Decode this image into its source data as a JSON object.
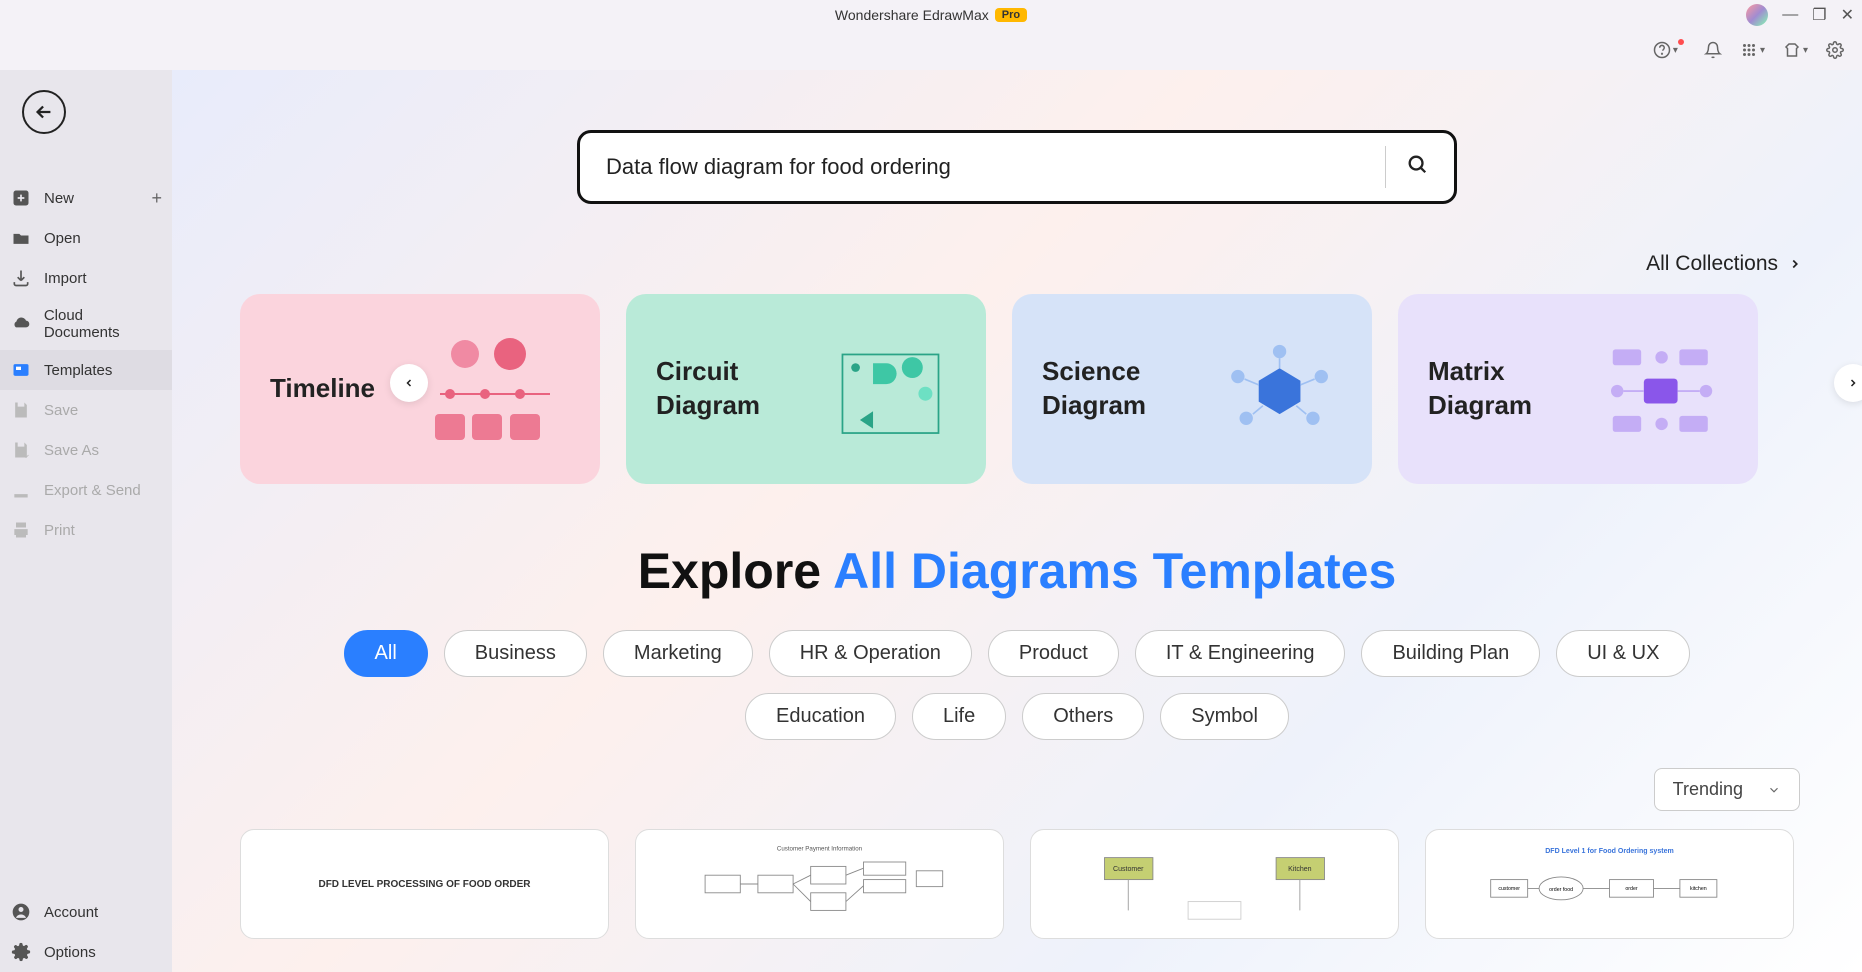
{
  "titlebar": {
    "app_name": "Wondershare EdrawMax",
    "badge": "Pro"
  },
  "sidebar": {
    "items": [
      {
        "label": "New",
        "icon": "plus-square",
        "has_plus": true
      },
      {
        "label": "Open",
        "icon": "folder"
      },
      {
        "label": "Import",
        "icon": "import"
      },
      {
        "label": "Cloud Documents",
        "icon": "cloud"
      },
      {
        "label": "Templates",
        "icon": "template",
        "active": true
      },
      {
        "label": "Save",
        "icon": "save",
        "disabled": true
      },
      {
        "label": "Save As",
        "icon": "saveas",
        "disabled": true
      },
      {
        "label": "Export & Send",
        "icon": "export",
        "disabled": true
      },
      {
        "label": "Print",
        "icon": "print",
        "disabled": true
      }
    ],
    "footer": [
      {
        "label": "Account",
        "icon": "account"
      },
      {
        "label": "Options",
        "icon": "gear"
      }
    ]
  },
  "search": {
    "value": "Data flow diagram for food ordering"
  },
  "collections_link": "All Collections",
  "categories": [
    {
      "title": "Timeline"
    },
    {
      "title": "Circuit Diagram"
    },
    {
      "title": "Science Diagram"
    },
    {
      "title": "Matrix Diagram"
    }
  ],
  "explore": {
    "prefix": "Explore ",
    "highlight": "All Diagrams Templates"
  },
  "filters": [
    "All",
    "Business",
    "Marketing",
    "HR & Operation",
    "Product",
    "IT & Engineering",
    "Building Plan",
    "UI & UX",
    "Education",
    "Life",
    "Others",
    "Symbol"
  ],
  "sort": {
    "selected": "Trending"
  },
  "templates": [
    {
      "caption": "DFD LEVEL PROCESSING OF FOOD ORDER"
    },
    {
      "caption": "Customer Payment Information"
    },
    {
      "caption": "Customer Kitchen"
    },
    {
      "caption": "DFD Level 1 for Food Ordering system"
    }
  ]
}
